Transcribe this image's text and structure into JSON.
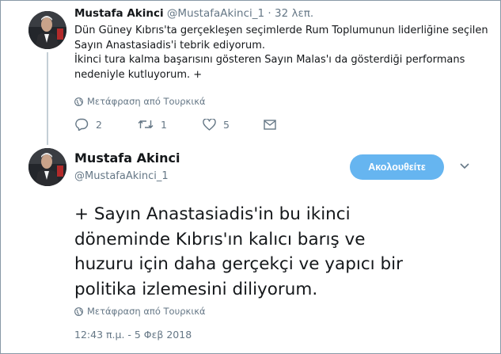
{
  "first_tweet": {
    "author_name": "Mustafa Akinci",
    "author_handle": "@MustafaAkinci_1",
    "separator": "·",
    "time": "32 λεπ.",
    "lines": [
      "Dün Güney Kıbrıs'ta gerçekleşen seçimlerde Rum Toplumunun liderliğine seçilen",
      "Sayın Anastasiadis'i tebrik ediyorum.",
      "İkinci tura kalma başarısını gösteren Sayın Malas'ı da gösterdiği performans",
      "nedeniyle kutluyorum. +"
    ],
    "translate_label": "Μετάφραση από Τουρκικά",
    "replies": "2",
    "retweets": "1",
    "likes": "5"
  },
  "second_tweet": {
    "author_name": "Mustafa Akinci",
    "author_handle": "@MustafaAkinci_1",
    "follow_label": "Ακολουθείτε",
    "lines": [
      "+ Sayın Anastasiadis'in bu ikinci",
      "döneminde Kıbrıs'ın kalıcı barış ve",
      "huzuru için daha gerçekçi ve yapıcı bir",
      "politika izlemesini diliyorum."
    ],
    "translate_label": "Μετάφραση από Τουρκικά",
    "timestamp": "12:43 π.μ. - 5 Φεβ 2018"
  },
  "icons": {
    "reply": "reply-icon",
    "retweet": "retweet-icon",
    "like": "heart-icon",
    "message": "envelope-icon",
    "globe": "globe-icon",
    "more": "chevron-down-icon"
  },
  "colors": {
    "follow_button": "#66b5f0",
    "muted_text": "#657786",
    "thread_line": "#c4cfd6"
  }
}
